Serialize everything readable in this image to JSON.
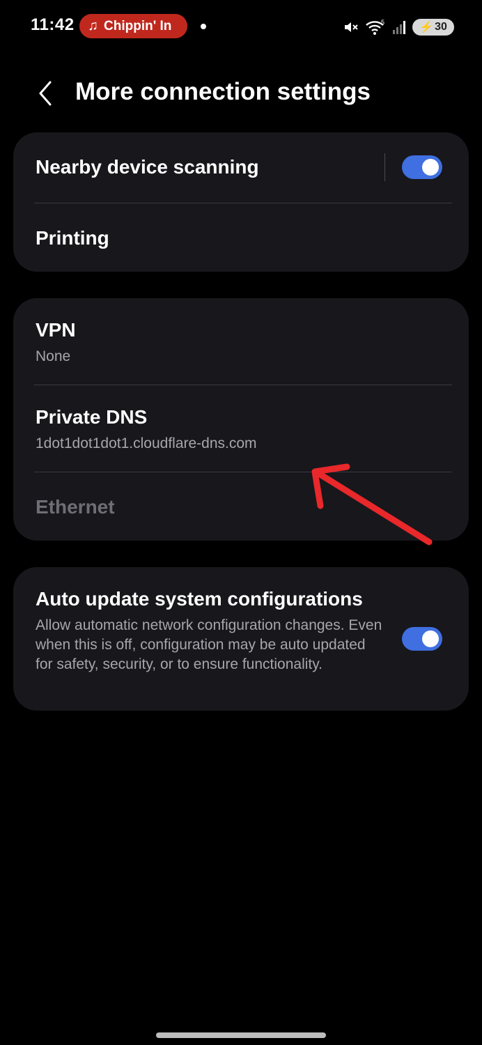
{
  "status_bar": {
    "time": "11:42",
    "media_chip_icon": "music-note-icon",
    "media_chip_text": "Chippin' In",
    "network_type": "5",
    "battery": "30",
    "colors": {
      "media_chip": "#c0281e"
    }
  },
  "header": {
    "title": "More connection settings",
    "back_icon": "chevron-left-icon"
  },
  "group1": {
    "nearby_scanning": {
      "label": "Nearby device scanning",
      "toggle_on": true
    },
    "printing": {
      "label": "Printing"
    }
  },
  "group2": {
    "vpn": {
      "label": "VPN",
      "value": "None"
    },
    "private_dns": {
      "label": "Private DNS",
      "value": "1dot1dot1dot1.cloudflare-dns.com"
    },
    "ethernet": {
      "label": "Ethernet"
    }
  },
  "group3": {
    "auto_update": {
      "label": "Auto update system configurations",
      "description": "Allow automatic network configuration changes. Even when this is off, configuration may be auto updated for safety, security, or to ensure functionality.",
      "toggle_on": true
    }
  },
  "colors": {
    "background": "#000000",
    "card": "#17171c",
    "toggle_accent": "#3f6fe0",
    "annotation_arrow": "#e8282a"
  }
}
